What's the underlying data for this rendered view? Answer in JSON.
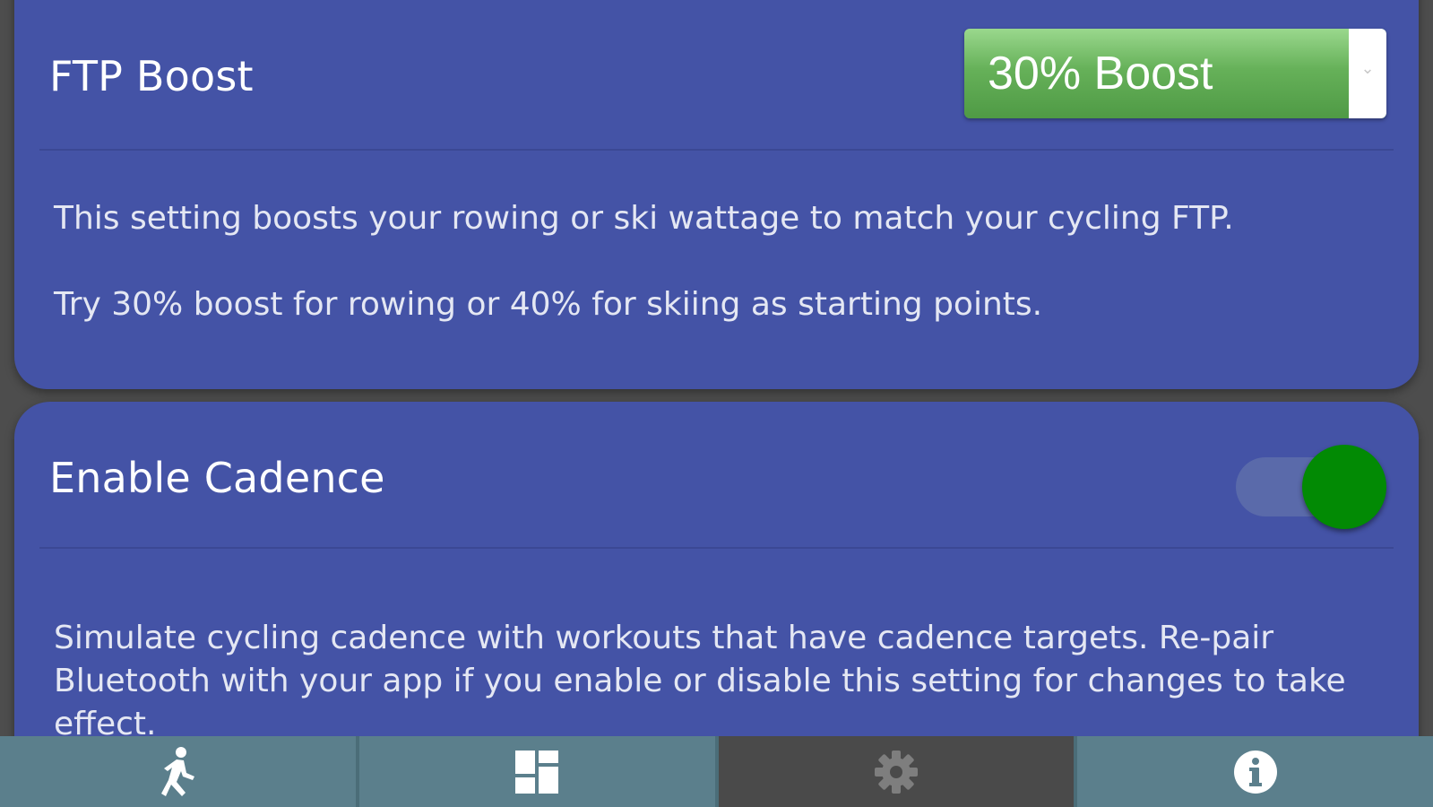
{
  "ftp_boost": {
    "title": "FTP Boost",
    "selected_value": "30% Boost",
    "arrow_icon": "chevron-down-icon",
    "description_1": "This setting boosts your rowing or ski wattage to match your cycling FTP.",
    "description_2": "Try 30% boost for rowing or 40% for skiing as starting points."
  },
  "cadence": {
    "title": "Enable Cadence",
    "enabled": true,
    "toggle_color": "#028a04",
    "description": "Simulate cycling cadence with workouts that have cadence targets. Re-pair Bluetooth with your app if you enable or disable this setting for changes to take effect."
  },
  "colors": {
    "card_background": "#4453a6",
    "page_background": "#4d4d4d",
    "nav_background": "#5b7f8c",
    "nav_active_background": "#4a4a4a",
    "select_green": "#66b159"
  },
  "bottom_nav": {
    "tabs": [
      {
        "icon": "workout-icon",
        "active": false
      },
      {
        "icon": "dashboard-icon",
        "active": false
      },
      {
        "icon": "gear-icon",
        "active": true
      },
      {
        "icon": "info-icon",
        "active": false
      }
    ]
  }
}
